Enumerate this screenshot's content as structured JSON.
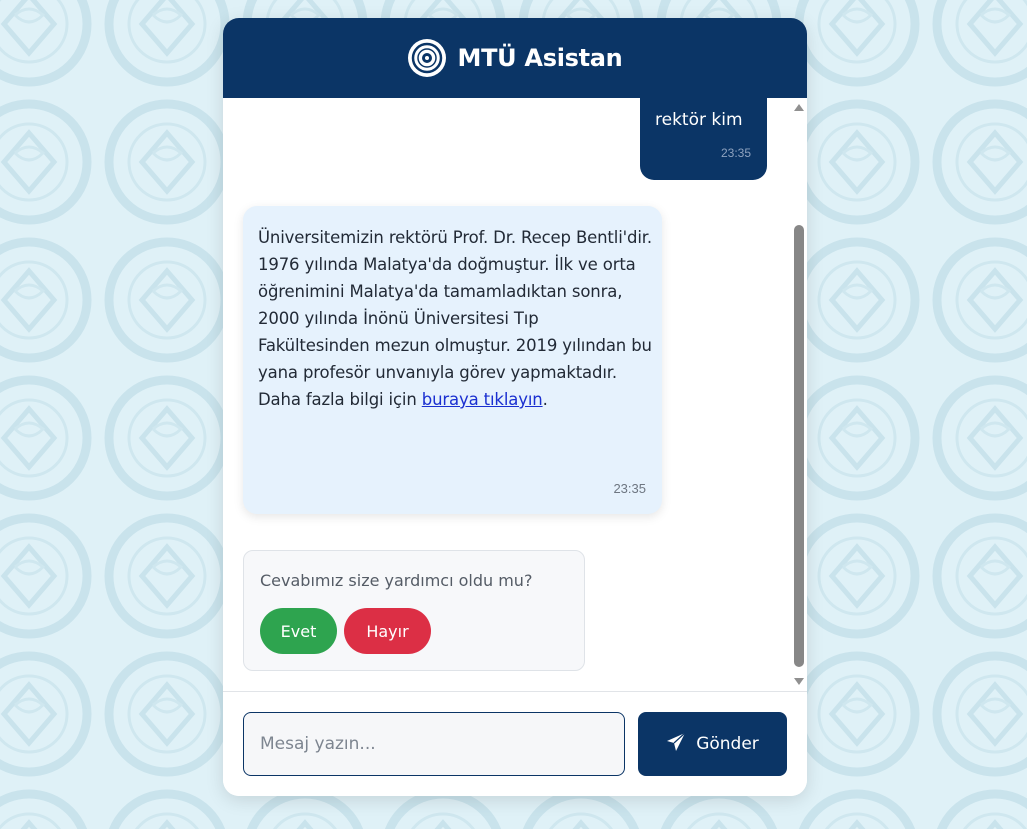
{
  "header": {
    "title": "MTÜ Asistan",
    "logo_icon": "university-seal-icon"
  },
  "messages": {
    "user": {
      "text": "rektör kim",
      "time": "23:35"
    },
    "bot": {
      "text": "Üniversitemizin rektörü Prof. Dr. Recep Bentli'dir. 1976 yılında Malatya'da doğmuştur. İlk ve orta öğrenimini Malatya'da tamamladıktan sonra, 2000 yılında İnönü Üniversitesi Tıp Fakültesinden mezun olmuştur. 2019 yılından bu yana profesör unvanıyla görev yapmaktadır. Daha fazla bilgi için",
      "link_text": "buraya tıklayın",
      "after_link": ".",
      "time": "23:35"
    }
  },
  "feedback": {
    "question": "Cevabımız size yardımcı oldu mu?",
    "yes_label": "Evet",
    "no_label": "Hayır"
  },
  "composer": {
    "placeholder": "Mesaj yazın...",
    "send_label": "Gönder",
    "send_icon": "paper-plane-icon"
  },
  "colors": {
    "primary": "#0b3566",
    "background": "#dff1f7",
    "bot_bubble": "#e6f2fd",
    "yes": "#2ea44f",
    "no": "#dc2f45"
  }
}
